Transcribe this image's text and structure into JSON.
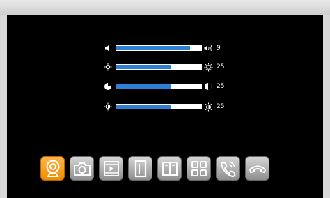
{
  "sliders": [
    {
      "name": "volume",
      "left_icon": "speaker-icon",
      "right_icon": "speaker-loud-icon",
      "value": "9",
      "fill_fraction": 0.87
    },
    {
      "name": "brightness",
      "left_icon": "sun-dim-icon",
      "right_icon": "sun-bright-icon",
      "value": "25",
      "fill_fraction": 0.64
    },
    {
      "name": "contrast",
      "left_icon": "contrast-low-icon",
      "right_icon": "contrast-high-icon",
      "value": "25",
      "fill_fraction": 0.64
    },
    {
      "name": "color",
      "left_icon": "color-low-icon",
      "right_icon": "color-high-icon",
      "value": "25",
      "fill_fraction": 0.64
    }
  ],
  "dock": [
    {
      "name": "camera-monitor",
      "icon": "webcam-icon",
      "active": true
    },
    {
      "name": "snapshot",
      "icon": "camera-icon",
      "active": false
    },
    {
      "name": "playback",
      "icon": "film-icon",
      "active": false
    },
    {
      "name": "door",
      "icon": "door-icon",
      "active": false
    },
    {
      "name": "gate",
      "icon": "gate-icon",
      "active": false
    },
    {
      "name": "menu",
      "icon": "grid-icon",
      "active": false
    },
    {
      "name": "call",
      "icon": "phone-ring-icon",
      "active": false
    },
    {
      "name": "hang-up",
      "icon": "hangup-icon",
      "active": false
    }
  ],
  "colors": {
    "accent": "#2d7fd6",
    "active_button": "#f59a10"
  }
}
